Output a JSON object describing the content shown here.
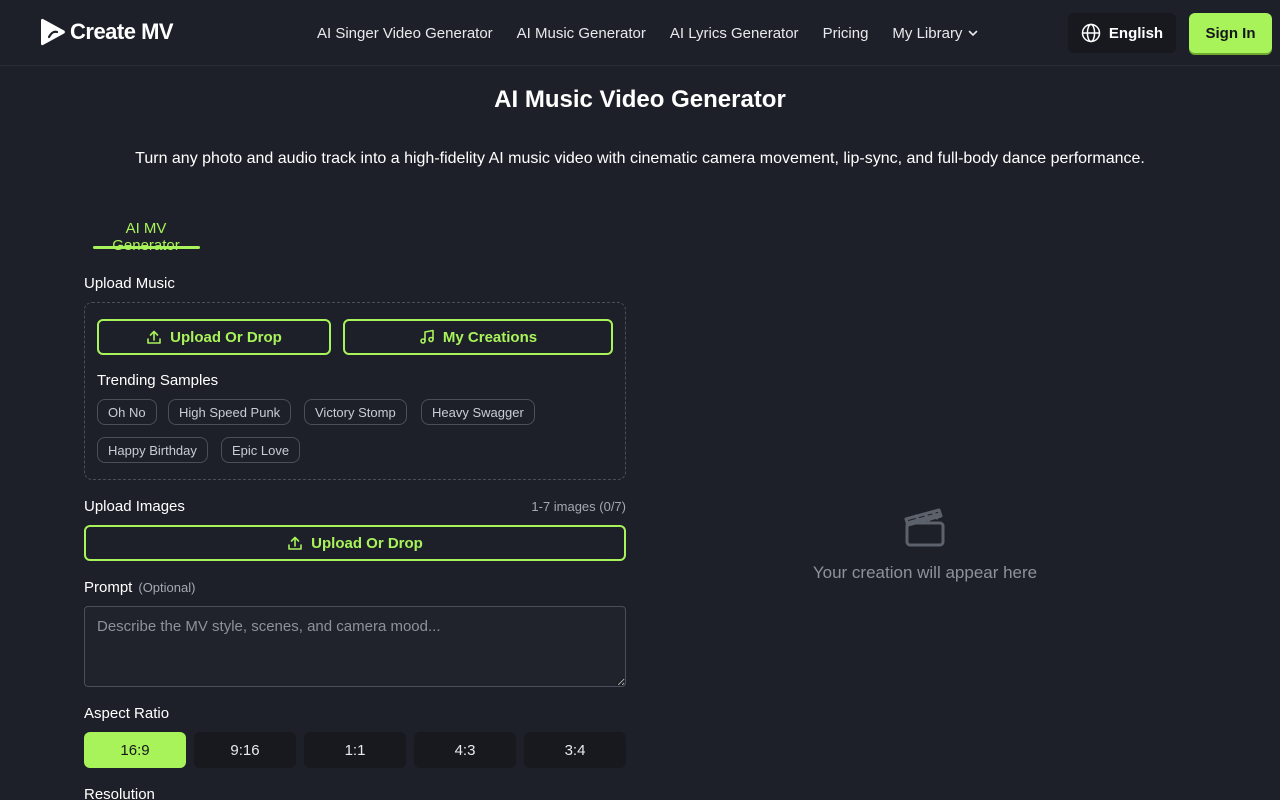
{
  "header": {
    "logo_text": "Create MV",
    "nav": [
      {
        "label": "AI Singer Video Generator"
      },
      {
        "label": "AI Music Generator"
      },
      {
        "label": "AI Lyrics Generator"
      },
      {
        "label": "Pricing"
      },
      {
        "label": "My Library"
      }
    ],
    "language": "English",
    "signin": "Sign In"
  },
  "page": {
    "title": "AI Music Video Generator",
    "subtitle": "Turn any photo and audio track into a high-fidelity AI music video with cinematic camera movement, lip-sync, and full-body dance performance."
  },
  "tabs": [
    {
      "label": "AI MV Generator"
    }
  ],
  "music": {
    "label": "Upload Music",
    "upload_btn": "Upload Or Drop",
    "creations_btn": "My Creations",
    "trending_label": "Trending Samples",
    "samples": [
      "Oh No",
      "High Speed Punk",
      "Victory Stomp",
      "Heavy Swagger",
      "Happy Birthday",
      "Epic Love"
    ]
  },
  "images": {
    "label": "Upload Images",
    "hint": "1-7 images (0/7)",
    "upload_btn": "Upload Or Drop"
  },
  "prompt": {
    "label": "Prompt",
    "optional": "(Optional)",
    "placeholder": "Describe the MV style, scenes, and camera mood..."
  },
  "aspect": {
    "label": "Aspect Ratio",
    "options": [
      "16:9",
      "9:16",
      "1:1",
      "4:3",
      "3:4"
    ],
    "selected": "16:9"
  },
  "resolution": {
    "label": "Resolution"
  },
  "preview": {
    "text": "Your creation will appear here"
  },
  "colors": {
    "accent": "#a8f25a",
    "background": "#1d2028"
  }
}
